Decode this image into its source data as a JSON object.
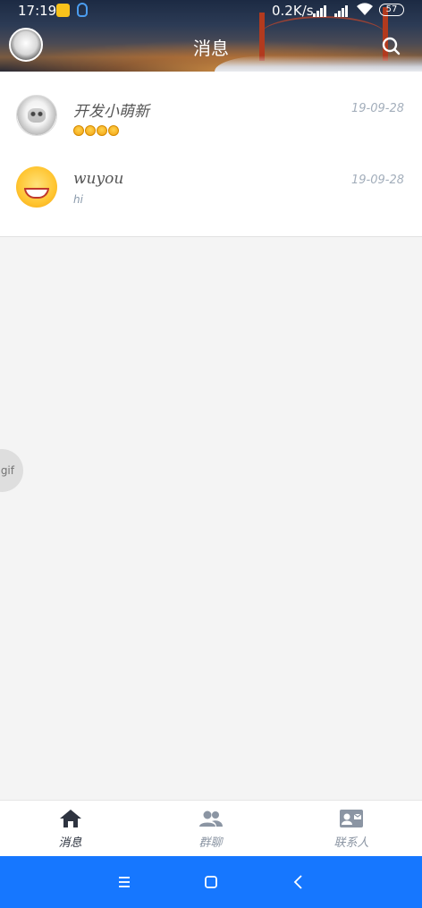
{
  "status_bar": {
    "time": "17:19",
    "network_speed": "0.2K/s",
    "battery": "57"
  },
  "app_bar": {
    "title": "消息",
    "search_icon": "search-icon"
  },
  "messages": [
    {
      "name": "开发小萌新",
      "preview": "",
      "preview_type": "emoji",
      "emoji_count": 4,
      "date": "19-09-28",
      "avatar": "meme-avatar"
    },
    {
      "name": "wuyou",
      "preview": "hi",
      "preview_type": "text",
      "date": "19-09-28",
      "avatar": "smile-avatar"
    }
  ],
  "floating": {
    "label": "gif"
  },
  "bottom_nav": [
    {
      "label": "消息",
      "icon": "home-icon",
      "active": true
    },
    {
      "label": "群聊",
      "icon": "group-icon",
      "active": false
    },
    {
      "label": "联系人",
      "icon": "contact-card-icon",
      "active": false
    }
  ],
  "system_nav": [
    "menu-icon",
    "home-square-icon",
    "back-icon"
  ],
  "colors": {
    "system_nav_bg": "#1677ff",
    "active_nav": "#2e3440",
    "inactive_nav": "#8b95a3"
  }
}
